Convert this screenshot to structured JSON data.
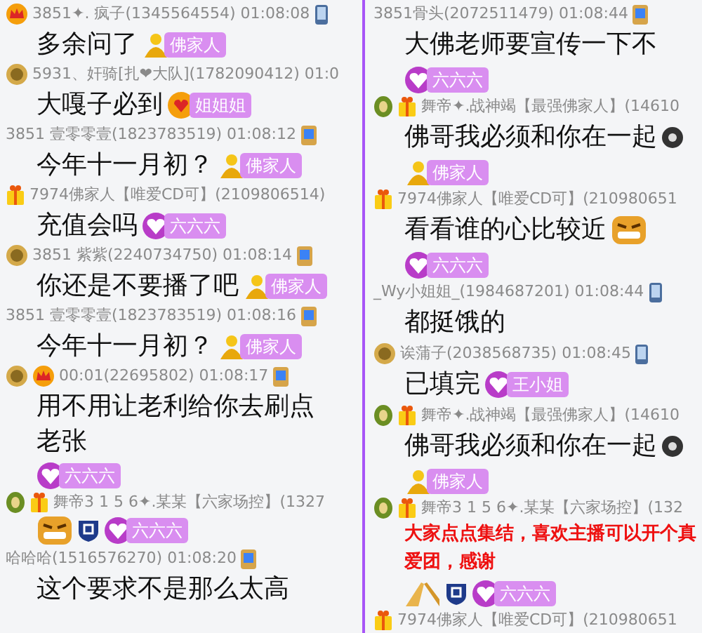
{
  "columns": [
    {
      "messages": [
        {
          "icons": [
            {
              "kind": "crown"
            }
          ],
          "meta": "3851✦. 疯子(1345564554) 01:08:08",
          "device": {
            "kind": "phone"
          },
          "text": "多余问了",
          "badges": [
            {
              "kind": "buddha",
              "label": "佛家人"
            }
          ]
        },
        {
          "icons": [
            {
              "kind": "medal"
            }
          ],
          "meta": "5931、奸骑[扎❤大队](1782090412) 01:0",
          "text": "大嘎子必到",
          "badges": [
            {
              "kind": "sun",
              "label": "姐姐姐"
            }
          ]
        },
        {
          "meta": "3851 壹零零壹(1823783519) 01:08:12",
          "device": {
            "kind": "pc"
          },
          "text": "今年十一月初？",
          "badges": [
            {
              "kind": "buddha",
              "label": "佛家人"
            }
          ]
        },
        {
          "icons": [
            {
              "kind": "gift"
            }
          ],
          "meta": "7974佛家人【唯爱CD可】(2109806514)",
          "text": "充值会吗",
          "badges": [
            {
              "kind": "heart",
              "label": "六六六"
            }
          ]
        },
        {
          "icons": [
            {
              "kind": "medal"
            }
          ],
          "meta": "3851 紫紫(2240734750) 01:08:14",
          "device": {
            "kind": "pc"
          },
          "text": "你还是不要播了吧",
          "badges": [
            {
              "kind": "buddha",
              "label": "佛家人"
            }
          ]
        },
        {
          "meta": "3851 壹零零壹(1823783519) 01:08:16",
          "device": {
            "kind": "pc"
          },
          "text": "今年十一月初？",
          "badges": [
            {
              "kind": "buddha",
              "label": "佛家人"
            }
          ]
        },
        {
          "icons": [
            {
              "kind": "medal"
            },
            {
              "kind": "crown"
            }
          ],
          "meta": "00:01(22695802) 01:08:17",
          "device": {
            "kind": "pc"
          },
          "text": "用不用让老利给你去刷点老张",
          "badges": [
            {
              "kind": "heart",
              "label": "六六六"
            }
          ]
        },
        {
          "icons": [
            {
              "kind": "leaf"
            },
            {
              "kind": "gift"
            }
          ],
          "meta": "舞帝3 1 5 6✦.某某【六家场控】(1327",
          "emojis": [
            {
              "kind": "face"
            },
            {
              "kind": "shield"
            }
          ],
          "badges": [
            {
              "kind": "heart",
              "label": "六六六"
            }
          ]
        },
        {
          "meta": "哈哈哈(1516576270) 01:08:20",
          "device": {
            "kind": "pc"
          },
          "text": "这个要求不是那么太高"
        }
      ]
    },
    {
      "messages": [
        {
          "meta": "3851骨头(2072511479) 01:08:44",
          "device": {
            "kind": "pc"
          },
          "text": "大佛老师要宣传一下不",
          "badges": [
            {
              "kind": "heart",
              "label": "六六六"
            }
          ]
        },
        {
          "icons": [
            {
              "kind": "leaf"
            },
            {
              "kind": "gift"
            }
          ],
          "meta": "舞帝✦.战神竭【最强佛家人】(14610",
          "text": "佛哥我必须和你在一起",
          "emojis": [
            {
              "kind": "gear"
            }
          ],
          "badges": [
            {
              "kind": "buddha",
              "label": "佛家人"
            }
          ]
        },
        {
          "icons": [
            {
              "kind": "gift"
            }
          ],
          "meta": "7974佛家人【唯爱CD可】(210980651",
          "text": "看看谁的心比较近",
          "emojis": [
            {
              "kind": "face"
            }
          ],
          "badges": [
            {
              "kind": "heart",
              "label": "六六六"
            }
          ]
        },
        {
          "meta": "_Wy小姐姐_(1984687201) 01:08:44",
          "device": {
            "kind": "phone"
          },
          "text": "都挺饿的"
        },
        {
          "icons": [
            {
              "kind": "medal"
            }
          ],
          "meta": "诶蒲子(2038568735) 01:08:45",
          "device": {
            "kind": "phone"
          },
          "text": "已填完",
          "badges": [
            {
              "kind": "heart",
              "label": "王小姐"
            }
          ]
        },
        {
          "icons": [
            {
              "kind": "leaf"
            },
            {
              "kind": "gift"
            }
          ],
          "meta": "舞帝✦.战神竭【最强佛家人】(14610",
          "text": "佛哥我必须和你在一起",
          "emojis": [
            {
              "kind": "gear"
            }
          ],
          "badges": [
            {
              "kind": "buddha",
              "label": "佛家人"
            }
          ]
        },
        {
          "icons": [
            {
              "kind": "leaf"
            },
            {
              "kind": "gift"
            }
          ],
          "meta": "舞帝3 1 5 6✦.某某【六家场控】(132",
          "text": "大家点点集结，喜欢主播可以开个真爱团，感谢",
          "highlight": true,
          "emojis": [
            {
              "kind": "hands"
            },
            {
              "kind": "shield"
            }
          ],
          "badges": [
            {
              "kind": "heart",
              "label": "六六六"
            }
          ]
        },
        {
          "icons": [
            {
              "kind": "gift"
            }
          ],
          "meta": "7974佛家人【唯爱CD可】(210980651"
        }
      ]
    }
  ]
}
